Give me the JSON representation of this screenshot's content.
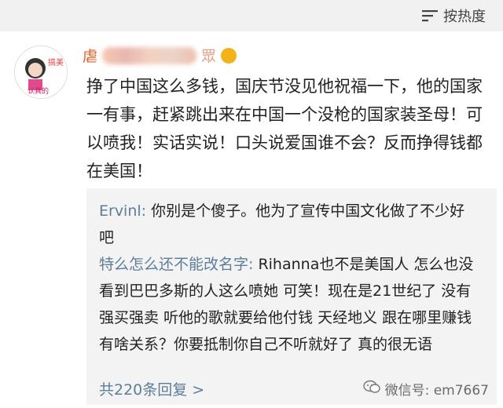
{
  "header": {
    "sort_label": "按热度"
  },
  "comment": {
    "username_prefix": "虐",
    "username_suffix": "眾",
    "avatar_label": "认真的",
    "text": "挣了中国这么多钱，国庆节没见他祝福一下，他的国家一有事，赶紧跳出来在中国一个没枪的国家装圣母！可以喷我！实话实说！口头说爱国谁不会？反而挣得钱都在美国！"
  },
  "replies": [
    {
      "author": "Ervinl:",
      "text": " 你别是个傻子。他为了宣传中国文化做了不少好吧"
    },
    {
      "author": "特么怎么还不能改名字:",
      "text": " Rihanna也不是美国人 怎么也没看到巴巴多斯的人这么喷她 可笑！现在是21世纪了 没有强买强卖 听他的歌就要给他付钱 天经地义 跟在哪里赚钱有啥关系？你要抵制你自己不听就好了 真的很无语"
    }
  ],
  "more_replies_label": "共220条回复 >",
  "watermark": "微信号: em7667",
  "colors": {
    "link": "#5e7d99",
    "username": "#e55e21",
    "topbar_bg": "#f1f1f1",
    "reply_bg": "#f3f3f3"
  }
}
